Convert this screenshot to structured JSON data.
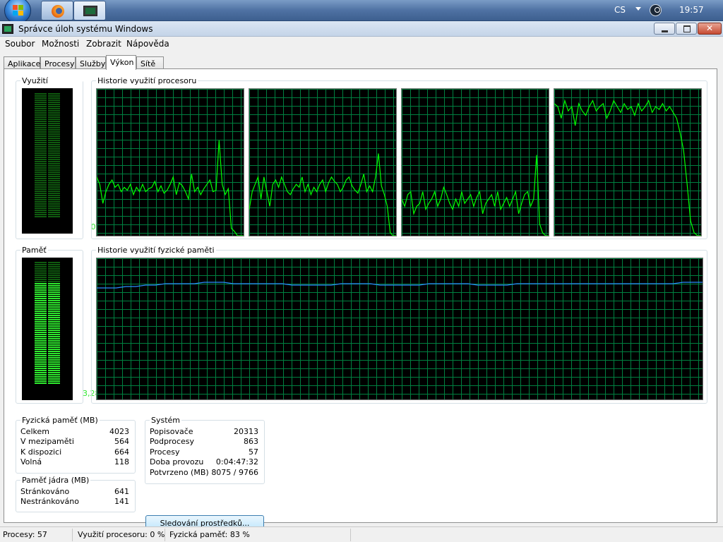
{
  "taskbar": {
    "language": "CS",
    "clock": "19:57",
    "colors": {
      "taskbar": "#4f72a3"
    }
  },
  "window": {
    "title": "Správce úloh systému Windows"
  },
  "menu": [
    "Soubor",
    "Možnosti",
    "Zobrazit",
    "Nápověda"
  ],
  "tabs": [
    {
      "label": "Aplikace",
      "active": false
    },
    {
      "label": "Procesy",
      "active": false
    },
    {
      "label": "Služby",
      "active": false
    },
    {
      "label": "Výkon",
      "active": true
    },
    {
      "label": "Sítě",
      "active": false
    }
  ],
  "performance": {
    "cpu_usage": {
      "label": "Využití procesoru",
      "value": "0 %",
      "level": 0
    },
    "cpu_history": {
      "label": "Historie využití procesoru",
      "cores": [
        [
          40,
          35,
          22,
          30,
          35,
          38,
          33,
          35,
          30,
          33,
          31,
          35,
          28,
          33,
          30,
          35,
          30,
          32,
          33,
          37,
          30,
          34,
          29,
          31,
          35,
          40,
          28,
          36,
          34,
          30,
          25,
          42,
          30,
          33,
          28,
          32,
          35,
          38,
          30,
          31,
          65,
          35,
          28,
          32,
          5,
          3,
          0,
          0,
          0
        ],
        [
          18,
          30,
          35,
          40,
          25,
          40,
          30,
          20,
          35,
          38,
          33,
          40,
          35,
          30,
          28,
          32,
          35,
          33,
          40,
          30,
          35,
          28,
          33,
          30,
          35,
          38,
          30,
          36,
          40,
          37,
          35,
          30,
          33,
          38,
          40,
          34,
          31,
          29,
          35,
          42,
          30,
          34,
          30,
          40,
          56,
          34,
          28,
          20,
          2,
          0,
          0
        ],
        [
          25,
          20,
          28,
          30,
          15,
          20,
          22,
          30,
          18,
          22,
          25,
          30,
          20,
          25,
          33,
          28,
          22,
          18,
          25,
          20,
          30,
          22,
          25,
          28,
          20,
          26,
          30,
          15,
          22,
          25,
          28,
          20,
          30,
          18,
          22,
          26,
          20,
          25,
          30,
          15,
          22,
          28,
          30,
          20,
          25,
          55,
          8,
          2,
          0,
          0
        ],
        [
          90,
          88,
          80,
          92,
          85,
          88,
          75,
          90,
          85,
          82,
          88,
          92,
          85,
          88,
          90,
          80,
          85,
          92,
          88,
          84,
          90,
          86,
          88,
          82,
          90,
          85,
          88,
          92,
          84,
          88,
          86,
          90,
          85,
          88,
          84,
          80,
          70,
          58,
          35,
          10,
          2,
          0,
          0
        ]
      ]
    },
    "memory": {
      "label": "Paměť",
      "value": "3,28 GB",
      "level": 0.83
    },
    "memory_history": {
      "label": "Historie využití fyzické paměti",
      "series": [
        79,
        79,
        79,
        80,
        80,
        81,
        81,
        82,
        82,
        82,
        82,
        83,
        83,
        83,
        82,
        82,
        82,
        82,
        82,
        82,
        81,
        81,
        81,
        81,
        81,
        82,
        82,
        82,
        82,
        81,
        81,
        81,
        81,
        81,
        82,
        82,
        82,
        82,
        82,
        81,
        81,
        81,
        81,
        82,
        82,
        82,
        82,
        82,
        82,
        82,
        82,
        82,
        82,
        82,
        82,
        82,
        82,
        82,
        82,
        82,
        83,
        83,
        83
      ]
    }
  },
  "physical_memory": {
    "label": "Fyzická paměť (MB)",
    "rows": [
      {
        "name": "Celkem",
        "value": "4023"
      },
      {
        "name": "V mezipaměti",
        "value": "564"
      },
      {
        "name": "K dispozici",
        "value": "664"
      },
      {
        "name": "Volná",
        "value": "118"
      }
    ]
  },
  "kernel_memory": {
    "label": "Paměť jádra (MB)",
    "rows": [
      {
        "name": "Stránkováno",
        "value": "641"
      },
      {
        "name": "Nestránkováno",
        "value": "141"
      }
    ]
  },
  "system": {
    "label": "Systém",
    "rows": [
      {
        "name": "Popisovače",
        "value": "20313"
      },
      {
        "name": "Podprocesy",
        "value": "863"
      },
      {
        "name": "Procesy",
        "value": "57"
      },
      {
        "name": "Doba provozu",
        "value": "0:04:47:32"
      },
      {
        "name": "Potvrzeno (MB)",
        "value": "8075 / 9766"
      }
    ]
  },
  "resource_monitor_button": "Sledování prostředků...",
  "statusbar": {
    "processes": "Procesy: 57",
    "cpu": "Využití procesoru: 0 %",
    "memory": "Fyzická paměť: 83 %"
  },
  "colors": {
    "graph_background": "#000000",
    "graph_grid": "#008040",
    "cpu_line": "#00ff00",
    "memory_line": "#2a8cff",
    "meter_on": "#2ee82e",
    "meter_off": "#0f5a0f"
  }
}
